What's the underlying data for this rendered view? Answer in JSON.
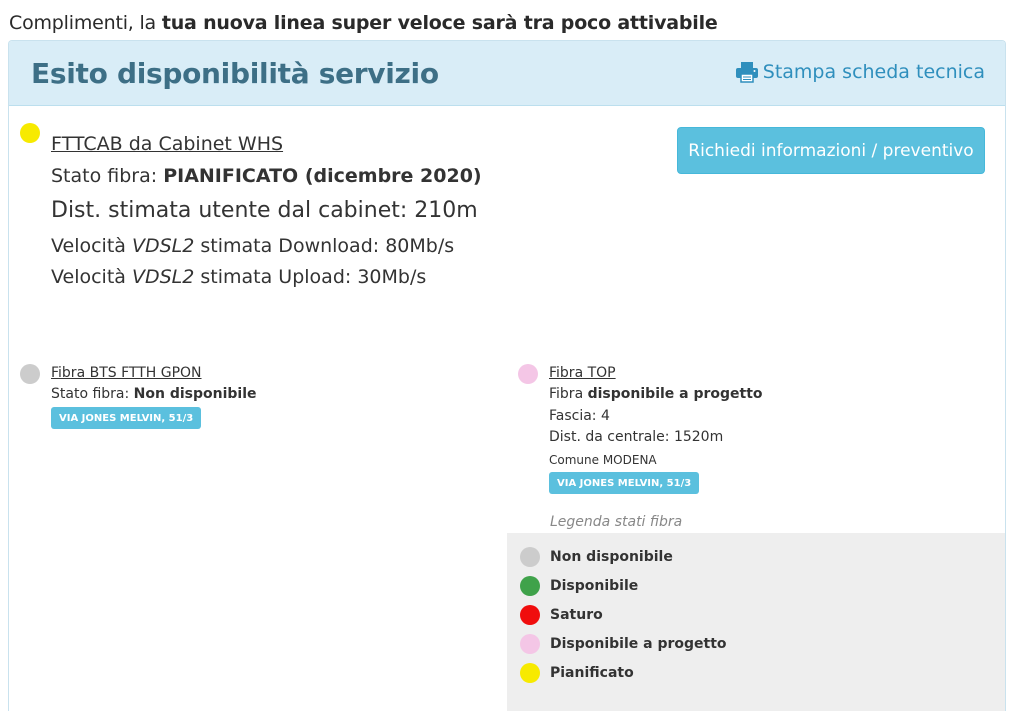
{
  "intro": {
    "prefix": "Complimenti, la ",
    "bold": "tua nuova linea super veloce sarà tra poco attivabile"
  },
  "panel": {
    "title": "Esito disponibilità servizio",
    "print_label": "Stampa scheda tecnica",
    "print_icon": "printer-icon"
  },
  "main_service": {
    "status_color": "#f7ea00",
    "name": "FTTCAB da Cabinet WHS",
    "stato_label": "Stato fibra: ",
    "stato_value": "PIANIFICATO (dicembre 2020)",
    "distance": "Dist. stimata utente dal cabinet: 210m",
    "download_prefix": "Velocità ",
    "download_tech": "VDSL2",
    "download_suffix": " stimata Download: 80Mb/s",
    "upload_prefix": "Velocità ",
    "upload_tech": "VDSL2",
    "upload_suffix": " stimata Upload: 30Mb/s",
    "button_label": "Richiedi informazioni / preventivo"
  },
  "service_bts": {
    "status_color": "#cccccc",
    "name": "Fibra BTS FTTH GPON",
    "stato_label": "Stato fibra: ",
    "stato_value": "Non disponibile",
    "address": "VIA JONES MELVIN, 51/3"
  },
  "service_top": {
    "status_color": "#f4c6e6",
    "name": "Fibra TOP",
    "stato_label": "Fibra ",
    "stato_value": "disponibile a progetto",
    "fascia": "Fascia: 4",
    "distance": "Dist. da centrale: 1520m",
    "comune": "Comune MODENA",
    "address": "VIA JONES MELVIN, 51/3"
  },
  "legend": {
    "title": "Legenda stati fibra",
    "items": [
      {
        "label": "Non disponibile",
        "color": "#cccccc"
      },
      {
        "label": "Disponibile",
        "color": "#3fa24a"
      },
      {
        "label": "Saturo",
        "color": "#f00d0d"
      },
      {
        "label": "Disponibile a progetto",
        "color": "#f4c6e6"
      },
      {
        "label": "Pianificato",
        "color": "#f7ea00"
      }
    ]
  }
}
